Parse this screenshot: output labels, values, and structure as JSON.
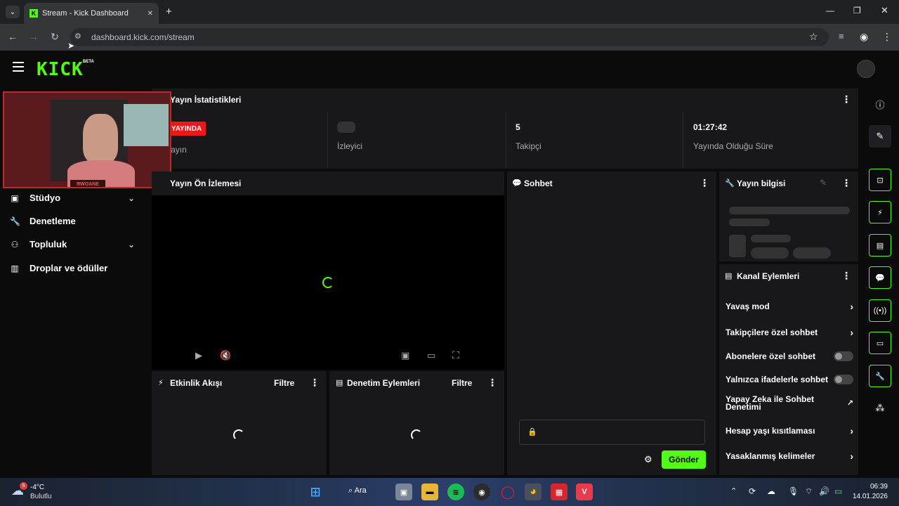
{
  "browser": {
    "tab_title": "Stream - Kick Dashboard",
    "url": "dashboard.kick.com/stream",
    "new_tab": "+",
    "tab_close": "✕"
  },
  "header": {
    "logo_text": "KICK",
    "logo_badge": "BETA"
  },
  "sidebar": {
    "items": [
      {
        "label": "Stüdyo",
        "icon": "studio-icon"
      },
      {
        "label": "Denetleme",
        "icon": "wrench-icon"
      },
      {
        "label": "Topluluk",
        "icon": "community-icon"
      },
      {
        "label": "Droplar ve ödüller",
        "icon": "drops-icon"
      }
    ],
    "webcam_name": "RWOANE"
  },
  "stats": {
    "title": "Yayın İstatistikleri",
    "live_badge": "YAYINDA",
    "live_label": "Yayın",
    "viewers_label": "İzleyici",
    "followers_value": "5",
    "followers_label": "Takipçi",
    "uptime_value": "01:27:42",
    "uptime_label": "Yayında Olduğu Süre"
  },
  "preview": {
    "title": "Yayın Ön İzlemesi"
  },
  "activity": {
    "title": "Etkinlik Akışı",
    "filter": "Filtre"
  },
  "moderation": {
    "title": "Denetim Eylemleri",
    "filter": "Filtre"
  },
  "chat": {
    "title": "Sohbet",
    "send": "Gönder",
    "input_placeholder": ""
  },
  "stream_info": {
    "title": "Yayın bilgisi"
  },
  "channel_actions": {
    "title": "Kanal Eylemleri",
    "items": [
      {
        "label": "Yavaş mod",
        "type": "chevron"
      },
      {
        "label": "Takipçilere özel sohbet",
        "type": "chevron"
      },
      {
        "label": "Abonelere özel sohbet",
        "type": "toggle",
        "on": false
      },
      {
        "label": "Yalnızca ifadelerle sohbet",
        "type": "toggle",
        "on": false
      },
      {
        "label": "Yapay Zeka ile Sohbet Denetimi",
        "type": "external"
      },
      {
        "label": "Hesap yaşı kısıtlaması",
        "type": "chevron"
      },
      {
        "label": "Yasaklanmış kelimeler",
        "type": "chevron"
      }
    ]
  },
  "taskbar": {
    "weather_temp": "-4°C",
    "weather_desc": "Bulutlu",
    "weather_badge": "5",
    "search_label": "Ara",
    "time": "06:39",
    "date": "14.01.2026"
  },
  "colors": {
    "accent": "#53fc18",
    "live": "#e91916",
    "panel": "#18181b"
  }
}
